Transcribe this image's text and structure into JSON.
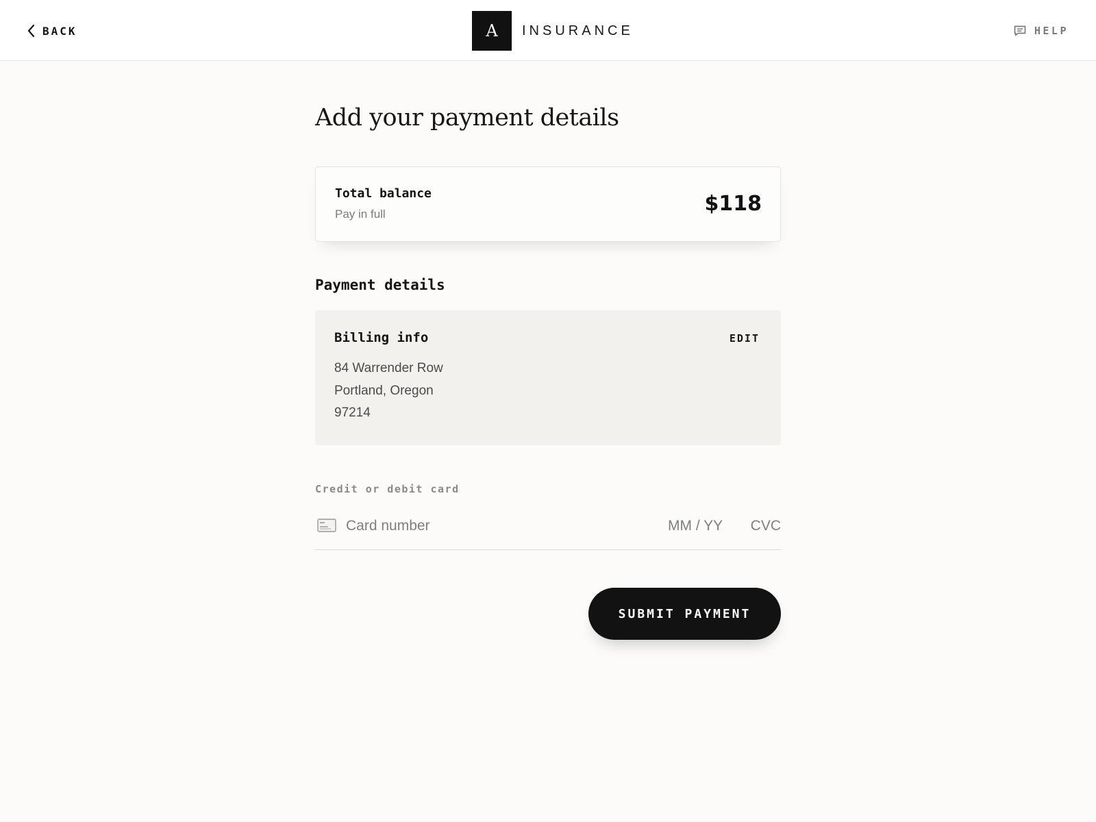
{
  "header": {
    "back_label": "BACK",
    "brand_mark": "A",
    "brand_name": "INSURANCE",
    "help_label": "HELP",
    "icons": {
      "back": "chevron-left-icon",
      "help": "chat-bubble-icon"
    }
  },
  "main": {
    "title": "Add your payment details",
    "balance": {
      "title": "Total balance",
      "subtitle": "Pay in full",
      "amount": "$118"
    },
    "payment_section_title": "Payment details",
    "billing": {
      "title": "Billing info",
      "edit_label": "EDIT",
      "address_line1": "84 Warrender Row",
      "address_line2": "Portland, Oregon",
      "postal_code": "97214"
    },
    "card": {
      "label": "Credit or debit card",
      "icon": "credit-card-icon",
      "number_value": "",
      "number_placeholder": "Card number",
      "expiry_value": "",
      "expiry_placeholder": "MM / YY",
      "cvc_value": "",
      "cvc_placeholder": "CVC"
    },
    "submit_label": "SUBMIT PAYMENT"
  },
  "colors": {
    "background": "#fcfbf9",
    "header_background": "#ffffff",
    "billing_background": "#f3f1ed",
    "primary": "#121212",
    "muted_text": "#7c7c7c"
  }
}
